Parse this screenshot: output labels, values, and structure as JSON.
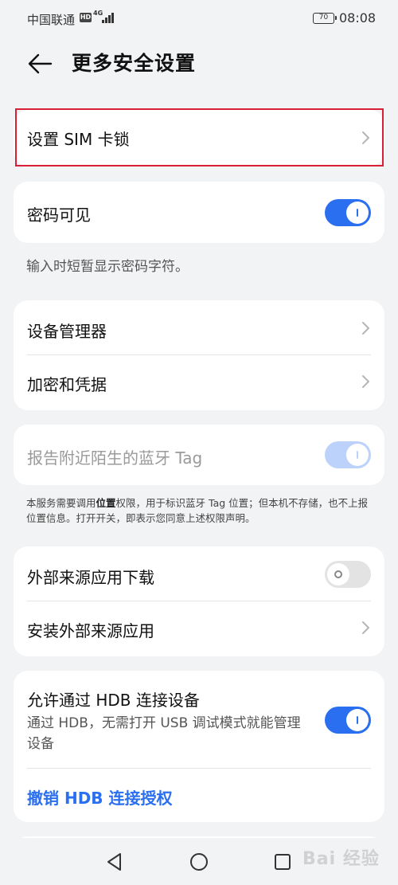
{
  "status_bar": {
    "carrier": "中国联通",
    "hd": "HD",
    "network": "4G",
    "battery": "70",
    "time": "08:08"
  },
  "header": {
    "title": "更多安全设置"
  },
  "sim_lock": {
    "label": "设置 SIM 卡锁"
  },
  "password_visible": {
    "label": "密码可见",
    "toggle": "on",
    "hint": "输入时短暂显示密码字符。"
  },
  "security_list": {
    "device_admin": "设备管理器",
    "encryption": "加密和凭据"
  },
  "bluetooth_tag": {
    "label": "报告附近陌生的蓝牙 Tag",
    "toggle": "disabled",
    "note_prefix": "本服务需要调用",
    "note_bold": "位置",
    "note_suffix": "权限，用于标识蓝牙 Tag 位置；但本机不存储，也不上报位置信息。打开开关，即表示您同意上述权限声明。"
  },
  "external_sources": {
    "download_label": "外部来源应用下载",
    "download_toggle": "off",
    "install_label": "安装外部来源应用"
  },
  "hdb": {
    "label": "允许通过 HDB 连接设备",
    "sub": "通过 HDB，无需打开 USB 调试模式就能管理设备",
    "toggle": "on",
    "revoke": "撤销 HDB 连接授权"
  },
  "watermark": "Bai 经验",
  "colors": {
    "accent": "#2a6ff0",
    "highlight": "#d91f36",
    "background": "#f1f3f5"
  }
}
